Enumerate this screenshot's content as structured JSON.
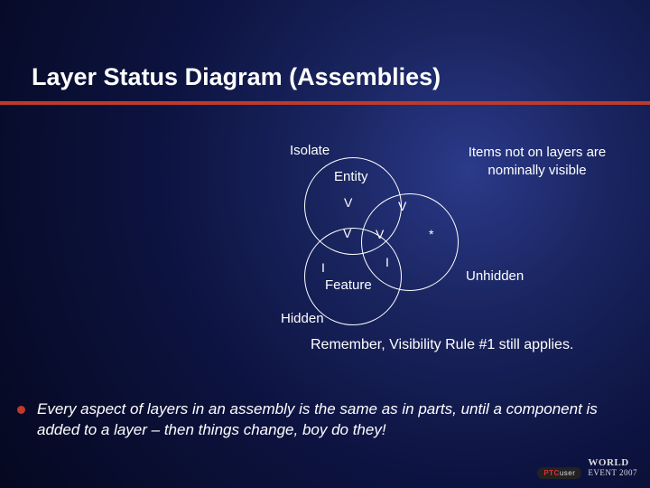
{
  "title": "Layer Status Diagram (Assemblies)",
  "venn": {
    "isolate": "Isolate",
    "entity": "Entity",
    "hidden": "Hidden",
    "feature": "Feature",
    "unhidden": "Unhidden",
    "v": "V",
    "i": "I",
    "star": "*"
  },
  "note": "Items not on layers are nominally visible",
  "reminder": "Remember, Visibility Rule #1 still applies.",
  "bullet": "Every aspect of layers in an assembly is the same as in parts, until a component is added to a layer – then things change, boy do they!",
  "logo": {
    "ptc_pre": "PTC",
    "ptc_suf": "user",
    "world": "WORLD",
    "event": "EVENT",
    "year": "2007"
  },
  "chart_data": {
    "type": "venn",
    "title": "Layer Status Diagram (Assemblies)",
    "sets": [
      "Isolate",
      "Entity",
      "Hidden"
    ],
    "regions": {
      "Isolate_only": "Entity",
      "Entity_only": "",
      "Hidden_only": "Feature",
      "Isolate_Entity": "V",
      "Isolate_Hidden": "V",
      "Entity_Hidden": "I",
      "Isolate_Entity_Hidden": "V",
      "Hidden_interior_left": "I"
    },
    "annotations": {
      "right_of_entity": "*",
      "right_label": "Unhidden",
      "note": "Items not on layers are nominally visible"
    }
  }
}
